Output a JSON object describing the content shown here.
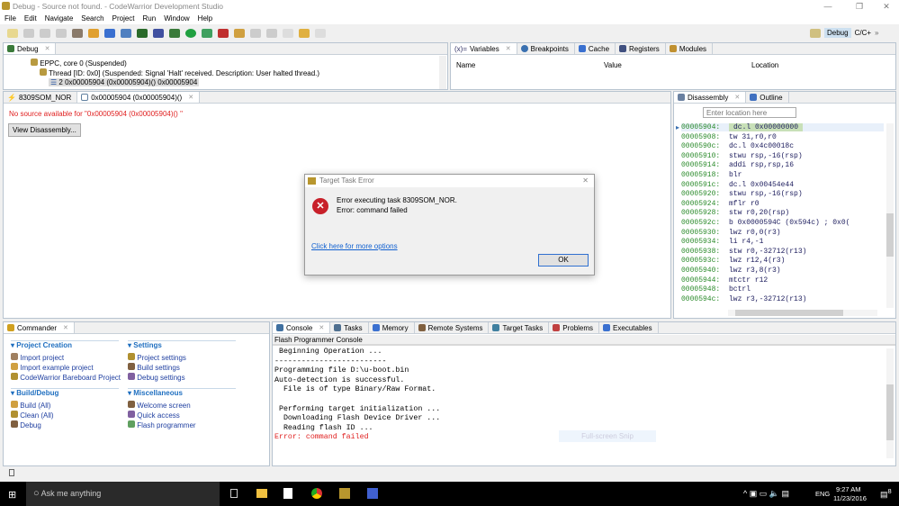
{
  "window": {
    "title": "Debug - Source not found. - CodeWarrior Development Studio",
    "minimize": "—",
    "restore": "❐",
    "close": "✕"
  },
  "menu": [
    "File",
    "Edit",
    "Navigate",
    "Search",
    "Project",
    "Run",
    "Window",
    "Help"
  ],
  "perspectives": {
    "debug": "Debug",
    "cpp": "C/C+",
    "more": "»"
  },
  "debug_view": {
    "tab": "Debug",
    "tree": [
      "EPPC, core 0 (Suspended)",
      "Thread [ID: 0x0] (Suspended: Signal 'Halt' received. Description: User halted thread.)",
      "2 0x00005904 (0x00005904)() 0x00005904"
    ]
  },
  "variables_view": {
    "tabs": [
      "Variables",
      "Breakpoints",
      "Cache",
      "Registers",
      "Modules"
    ],
    "columns": [
      "Name",
      "Value",
      "Location"
    ]
  },
  "editor": {
    "tabs": [
      "8309SOM_NOR",
      "0x00005904 (0x00005904)()"
    ],
    "message": "No source available for \"0x00005904 (0x00005904)() \"",
    "button": "View Disassembly..."
  },
  "disassembly": {
    "tabs": [
      "Disassembly",
      "Outline"
    ],
    "location_placeholder": "Enter location here",
    "rows": [
      {
        "addr": "00005904:",
        "instr": "dc.l 0x00000000"
      },
      {
        "addr": "00005908:",
        "instr": "tw 31,r0,r0"
      },
      {
        "addr": "0000590c:",
        "instr": "dc.l 0x4c00018c"
      },
      {
        "addr": "00005910:",
        "instr": "stwu rsp,-16(rsp)"
      },
      {
        "addr": "00005914:",
        "instr": "addi rsp,rsp,16"
      },
      {
        "addr": "00005918:",
        "instr": "blr"
      },
      {
        "addr": "0000591c:",
        "instr": "dc.l 0x00454e44"
      },
      {
        "addr": "00005920:",
        "instr": "stwu rsp,-16(rsp)"
      },
      {
        "addr": "00005924:",
        "instr": "mflr r0"
      },
      {
        "addr": "00005928:",
        "instr": "stw r0,20(rsp)"
      },
      {
        "addr": "0000592c:",
        "instr": "b 0x0000594C (0x594c)      ; 0x0("
      },
      {
        "addr": "00005930:",
        "instr": "lwz r0,0(r3)"
      },
      {
        "addr": "00005934:",
        "instr": "li r4,-1"
      },
      {
        "addr": "00005938:",
        "instr": "stw r0,-32712(r13)"
      },
      {
        "addr": "0000593c:",
        "instr": "lwz r12,4(r3)"
      },
      {
        "addr": "00005940:",
        "instr": "lwz r3,8(r3)"
      },
      {
        "addr": "00005944:",
        "instr": "mtctr r12"
      },
      {
        "addr": "00005948:",
        "instr": "bctrl"
      },
      {
        "addr": "0000594c:",
        "instr": "lwz r3,-32712(r13)"
      }
    ]
  },
  "commander": {
    "tab": "Commander",
    "sections": [
      {
        "title": "Project Creation",
        "items": [
          "Import project",
          "Import example project",
          "CodeWarrior Bareboard Project"
        ]
      },
      {
        "title": "Build/Debug",
        "items": [
          "Build   (All)",
          "Clean   (All)",
          "Debug"
        ]
      },
      {
        "title": "Settings",
        "items": [
          "Project settings",
          "Build settings",
          "Debug settings"
        ]
      },
      {
        "title": "Miscellaneous",
        "items": [
          "Welcome screen",
          "Quick access",
          "Flash programmer"
        ]
      }
    ]
  },
  "console": {
    "tabs": [
      "Console",
      "Tasks",
      "Memory",
      "Remote Systems",
      "Target Tasks",
      "Problems",
      "Executables"
    ],
    "title": "Flash Programmer Console",
    "lines": [
      " Beginning Operation ...",
      "-------------------------",
      "Programming file D:\\u-boot.bin",
      "Auto-detection is successful.",
      "  File is of type Binary/Raw Format.",
      "",
      " Performing target initialization ...",
      "  Downloading Flash Device Driver ...",
      "  Reading flash ID ..."
    ],
    "error": "Error: command failed",
    "snip_overlay": "Full-screen Snip"
  },
  "dialog": {
    "title": "Target Task Error",
    "line1": "Error executing task 8309SOM_NOR.",
    "line2": "Error: command failed",
    "link": "Click here for more options",
    "ok": "OK"
  },
  "taskbar": {
    "search": "Ask me anything",
    "time": "9:27 AM",
    "date": "11/23/2016",
    "lang": "ENG",
    "notifications": "8"
  }
}
